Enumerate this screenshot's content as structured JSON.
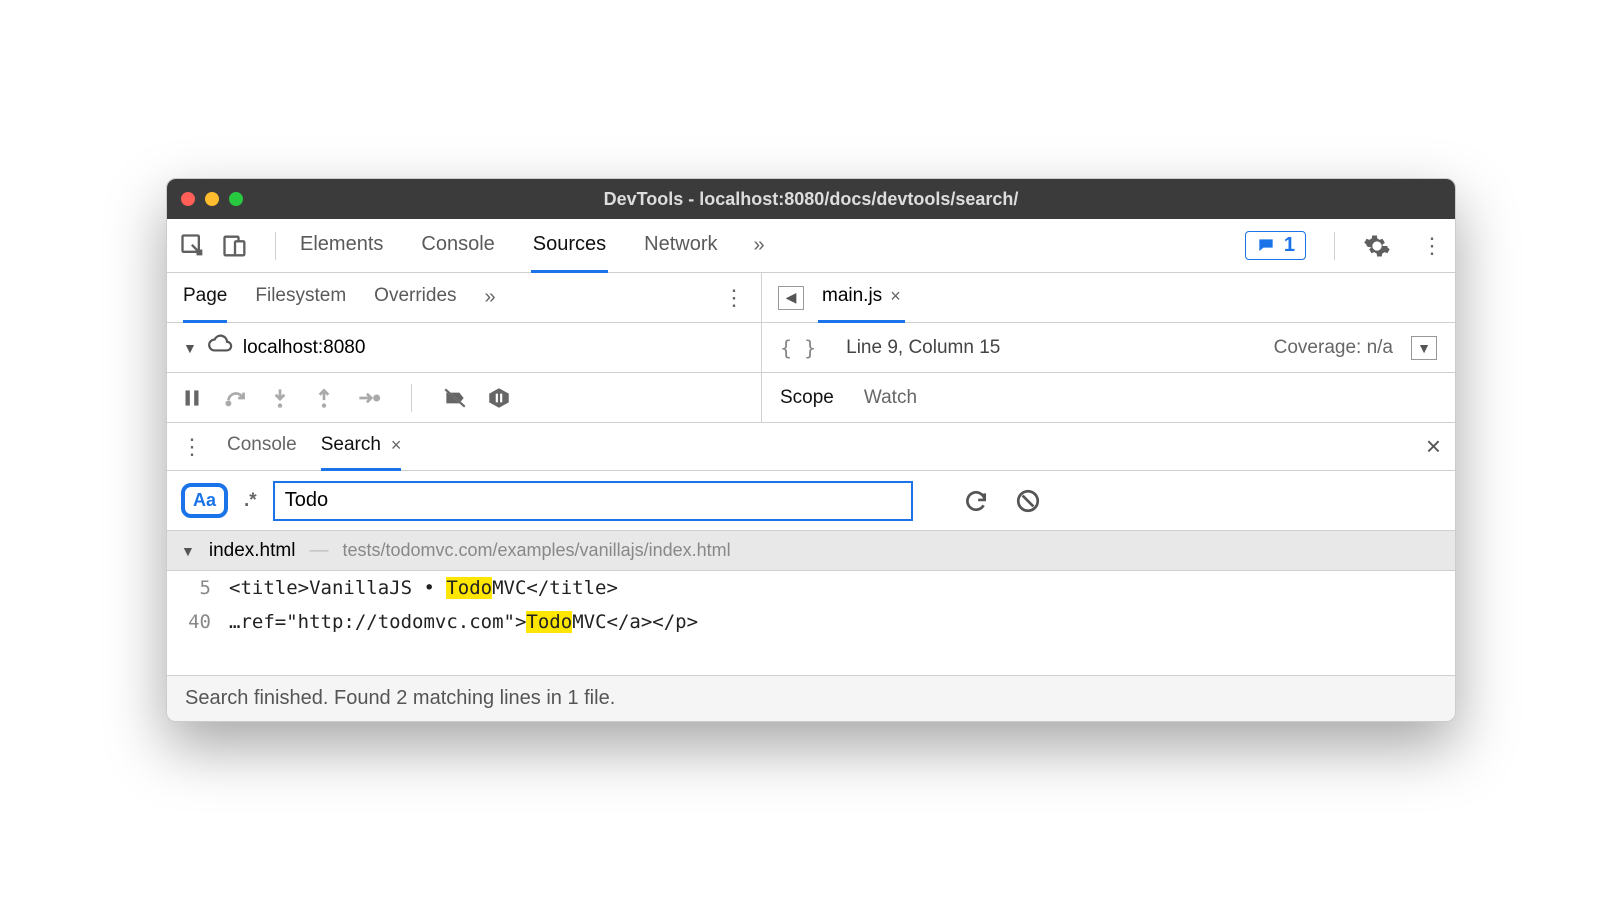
{
  "window": {
    "title": "DevTools - localhost:8080/docs/devtools/search/"
  },
  "mainTabs": {
    "t0": "Elements",
    "t1": "Console",
    "t2": "Sources",
    "t3": "Network"
  },
  "feedback_count": "1",
  "panelTabs": {
    "p0": "Page",
    "p1": "Filesystem",
    "p2": "Overrides"
  },
  "fileTab": "main.js",
  "tree_root": "localhost:8080",
  "cursor_pos": "Line 9, Column 15",
  "coverage": "Coverage: n/a",
  "watchTabs": {
    "w0": "Scope",
    "w1": "Watch"
  },
  "drawerTabs": {
    "d0": "Console",
    "d1": "Search"
  },
  "search": {
    "aa": "Aa",
    "regex": ".*",
    "value": "Todo"
  },
  "results": {
    "file_name": "index.html",
    "file_path": "tests/todomvc.com/examples/vanillajs/index.html",
    "lines": [
      {
        "num": "5",
        "pre": "<title>VanillaJS • ",
        "hl": "Todo",
        "post": "MVC</title>"
      },
      {
        "num": "40",
        "pre": "…ref=\"http://todomvc.com\">",
        "hl": "Todo",
        "post": "MVC</a></p>"
      }
    ]
  },
  "status": "Search finished.  Found 2 matching lines in 1 file."
}
